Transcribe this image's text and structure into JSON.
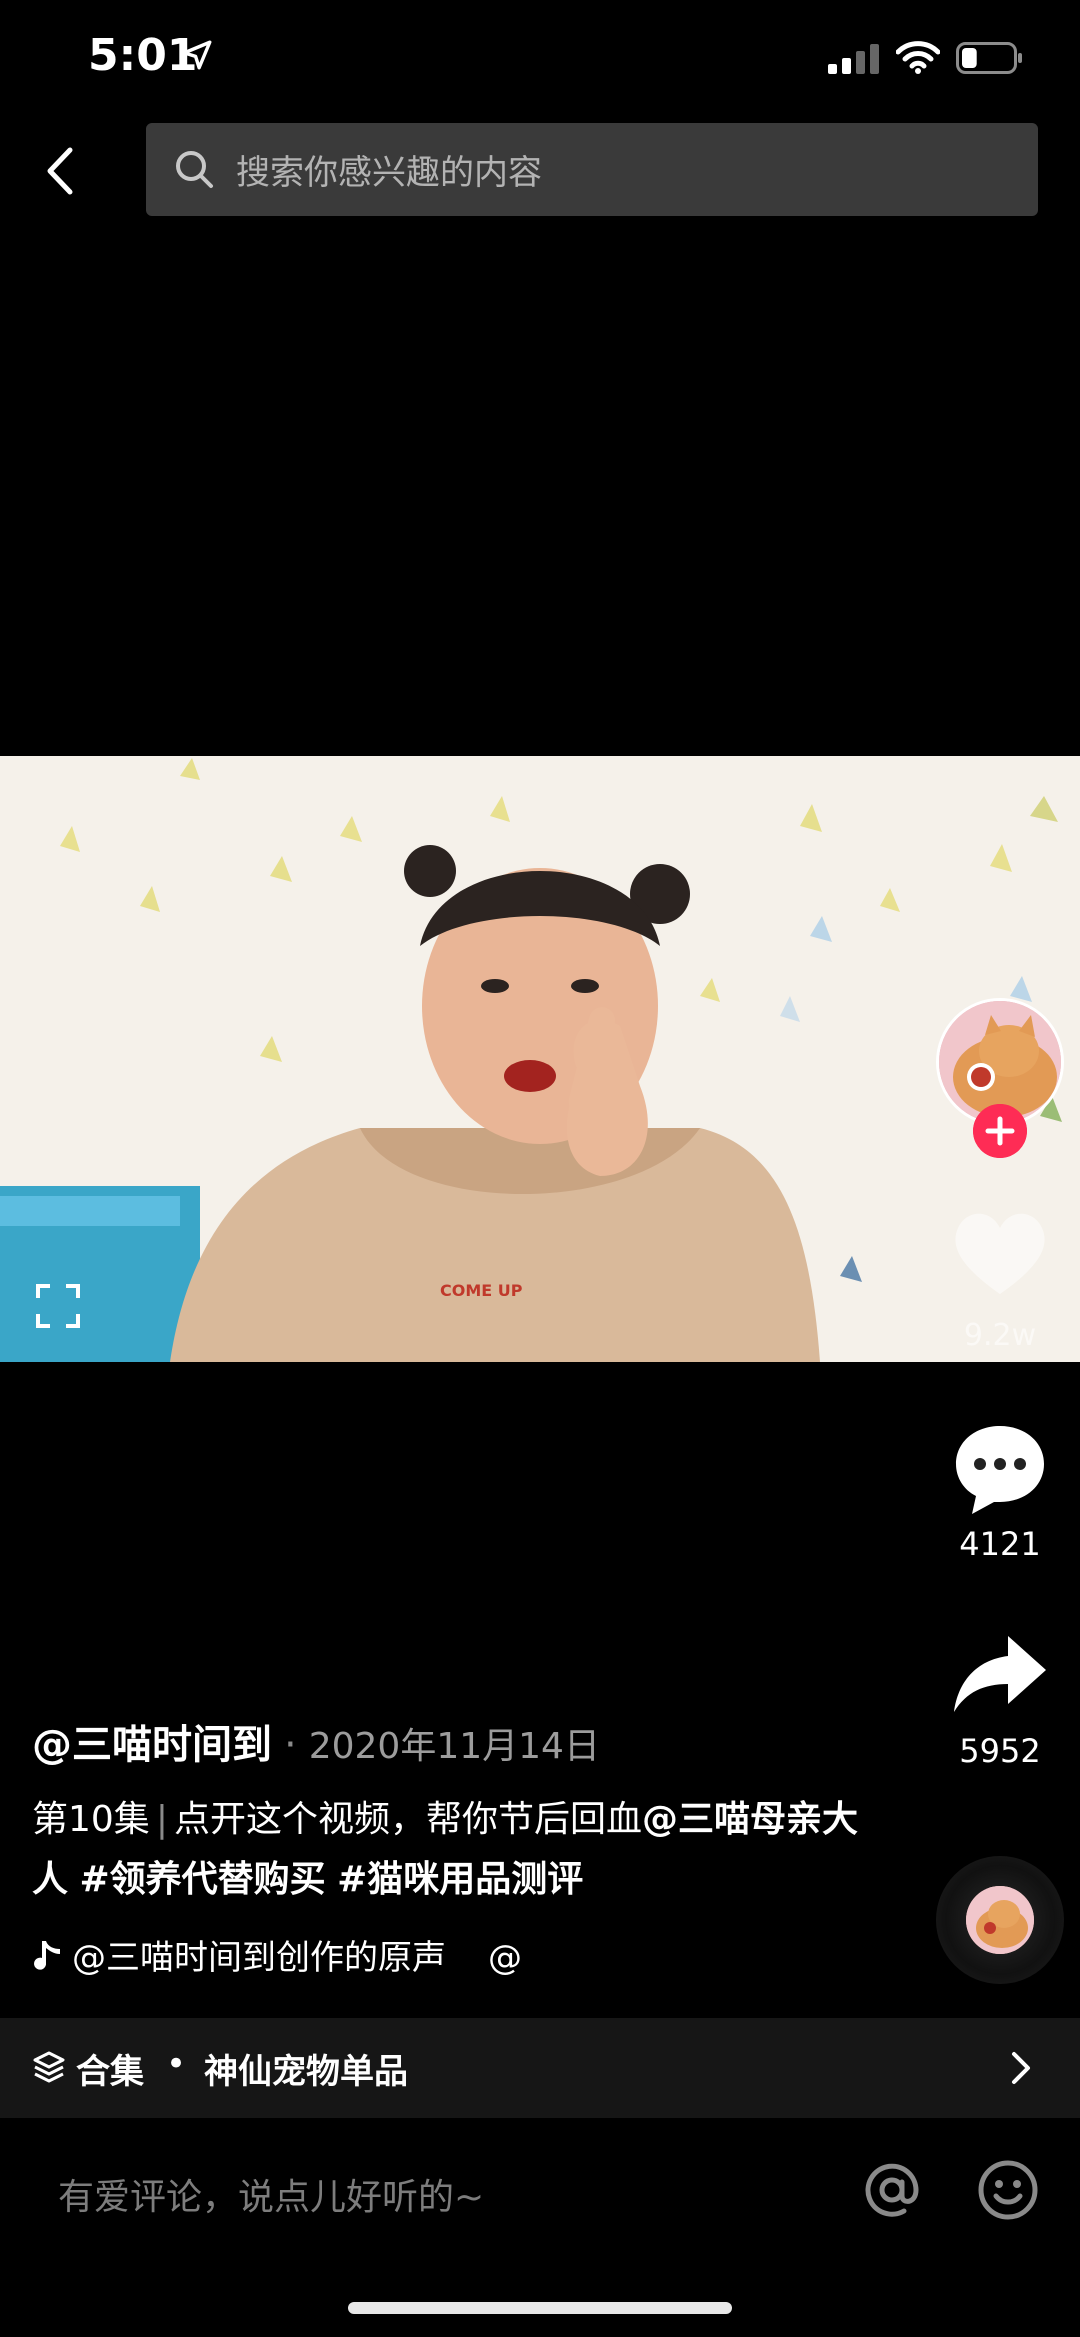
{
  "status_bar": {
    "time": "5:01",
    "battery_level": 0.3
  },
  "search": {
    "placeholder": "搜索你感兴趣的内容"
  },
  "video": {
    "subject": "woman in beige hoodie pointing finger",
    "shirt_text": "COME UP"
  },
  "actions": {
    "like_count": "9.2w",
    "comment_count": "4121",
    "share_count": "5952"
  },
  "post": {
    "author": "@三喵时间到",
    "separator": "·",
    "date": "2020年11月14日",
    "caption_episode": "第10集",
    "caption_sep": "|",
    "caption_text": "点开这个视频，帮你节后回血",
    "mention": "@三喵母亲大人",
    "tags": [
      "#领养代替购买",
      "#猫咪用品测评"
    ],
    "music_text": "@三喵时间到创作的原声",
    "music_at": "@"
  },
  "collection": {
    "label": "合集",
    "dot": "•",
    "name": "神仙宠物单品"
  },
  "comment_bar": {
    "placeholder": "有爱评论，说点儿好听的~"
  },
  "colors": {
    "accent": "#fe2c55",
    "background": "#000000",
    "search_bg": "#3a3a3a",
    "collection_bg": "#161616"
  },
  "icons": [
    "location-arrow-icon",
    "signal-icon",
    "wifi-icon",
    "battery-icon",
    "back-chevron-icon",
    "search-icon",
    "fullscreen-icon",
    "plus-icon",
    "heart-icon",
    "comment-bubble-icon",
    "share-arrow-icon",
    "music-note-icon",
    "stack-icon",
    "chevron-right-icon",
    "at-icon",
    "emoji-icon"
  ]
}
